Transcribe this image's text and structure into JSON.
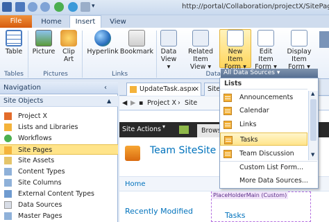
{
  "titlebar": {
    "url": "http://portal/Collaboration/projectX/SitePages"
  },
  "tabs": {
    "file": "File",
    "home": "Home",
    "insert": "Insert",
    "view": "View"
  },
  "ribbon": {
    "table": "Table",
    "picture": "Picture",
    "clip_art": "Clip Art",
    "hyperlink": "Hyperlink",
    "bookmark": "Bookmark",
    "data_view": "Data View ▾",
    "related_item_view": "Related Item View ▾",
    "new_item_form": "New Item Form ▾",
    "edit_item_form": "Edit Item Form ▾",
    "display_item_form": "Display Item Form ▾",
    "groups": {
      "tables": "Tables",
      "pictures": "Pictures",
      "links": "Links",
      "data": "Data"
    }
  },
  "dropdown": {
    "button": "All Data Sources ▾",
    "section": "Lists",
    "items": [
      "Announcements",
      "Calendar",
      "Links",
      "Tasks",
      "Team Discussion"
    ],
    "custom": "Custom List Form...",
    "more": "More Data Sources..."
  },
  "navigation": {
    "header": "Navigation",
    "section": "Site Objects",
    "items": [
      "Project X",
      "Lists and Libraries",
      "Workflows",
      "Site Pages",
      "Site Assets",
      "Content Types",
      "Site Columns",
      "External Content Types",
      "Data Sources",
      "Master Pages"
    ]
  },
  "editor": {
    "tab1": "UpdateTask.aspx",
    "tab2": "Site",
    "breadcrumb": "Project X",
    "breadcrumb2": "Site",
    "site_actions": "Site Actions",
    "browse": "Brows",
    "site_title": "Team SiteSite P",
    "home": "Home",
    "placeholder": "PlaceHolderMain (Custom)",
    "recently_modified": "Recently Modified",
    "tasks": "Tasks"
  },
  "colors": {
    "accent": "#f5c242",
    "file_tab": "#e06c1f",
    "selection": "#ffe48a"
  }
}
